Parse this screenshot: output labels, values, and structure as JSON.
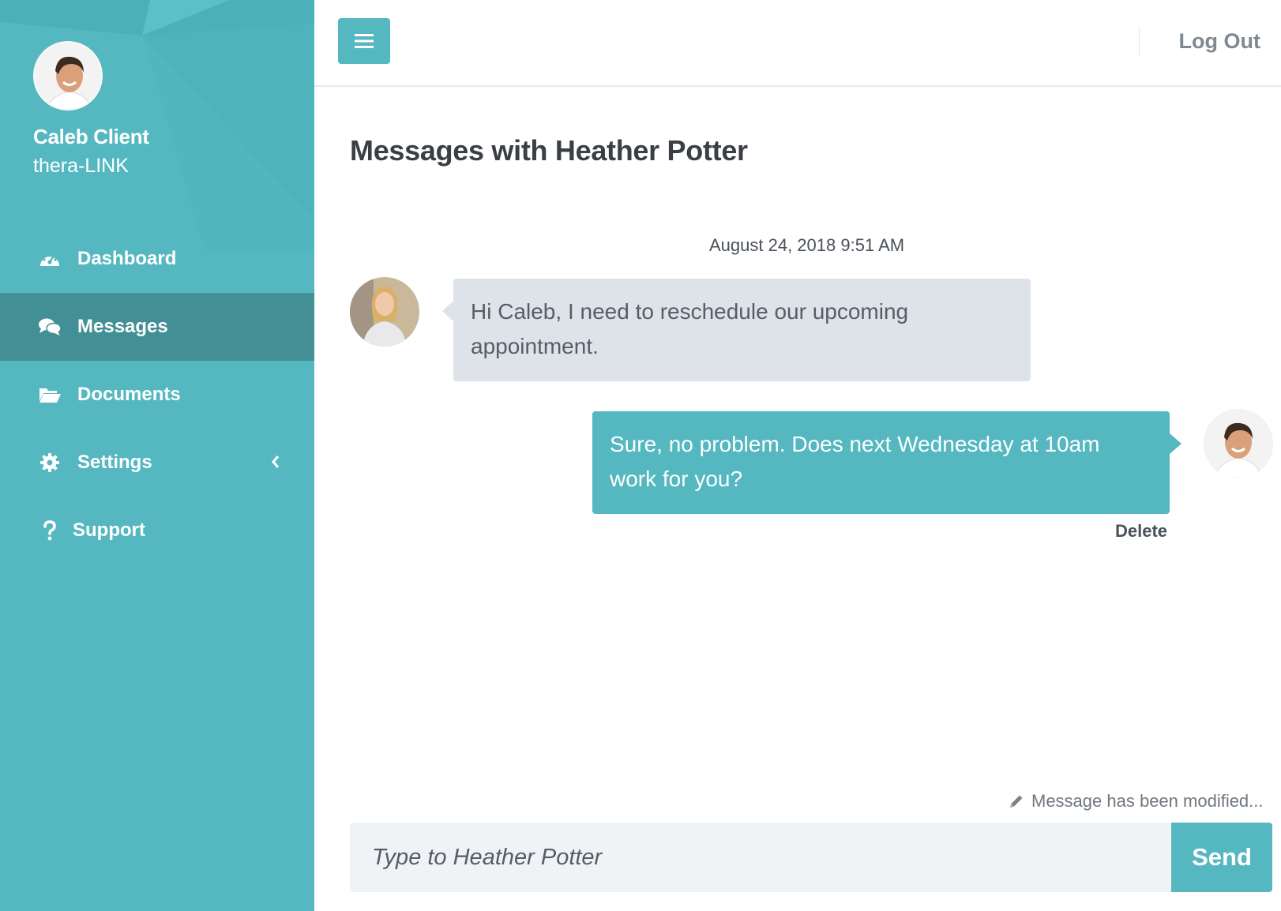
{
  "colors": {
    "accent": "#55b8c1",
    "active_nav": "#438f96",
    "incoming_bubble": "#dde3e8",
    "title": "#3a3f45"
  },
  "user": {
    "name": "Caleb Client",
    "org": "thera-LINK"
  },
  "sidebar": {
    "items": [
      {
        "label": "Dashboard",
        "icon": "dashboard-gauge-icon",
        "active": false
      },
      {
        "label": "Messages",
        "icon": "chat-bubbles-icon",
        "active": true
      },
      {
        "label": "Documents",
        "icon": "folder-open-icon",
        "active": false
      },
      {
        "label": "Settings",
        "icon": "gear-icon",
        "active": false,
        "has_submenu": true
      },
      {
        "label": "Support",
        "icon": "question-mark-icon",
        "active": false
      }
    ]
  },
  "topbar": {
    "menu_icon": "hamburger-menu-icon",
    "logout_label": "Log Out"
  },
  "main": {
    "title": "Messages with Heather Potter",
    "timestamp": "August 24, 2018 9:51 AM",
    "messages": [
      {
        "direction": "incoming",
        "sender": "Heather Potter",
        "text": "Hi Caleb, I need to reschedule our upcoming appointment."
      },
      {
        "direction": "outgoing",
        "sender": "Caleb Client",
        "text": "Sure, no problem. Does next Wednesday at 10am work for you?",
        "action_label": "Delete"
      }
    ],
    "status_text": "Message has been modified...",
    "composer": {
      "placeholder": "Type to Heather Potter",
      "send_label": "Send"
    }
  }
}
